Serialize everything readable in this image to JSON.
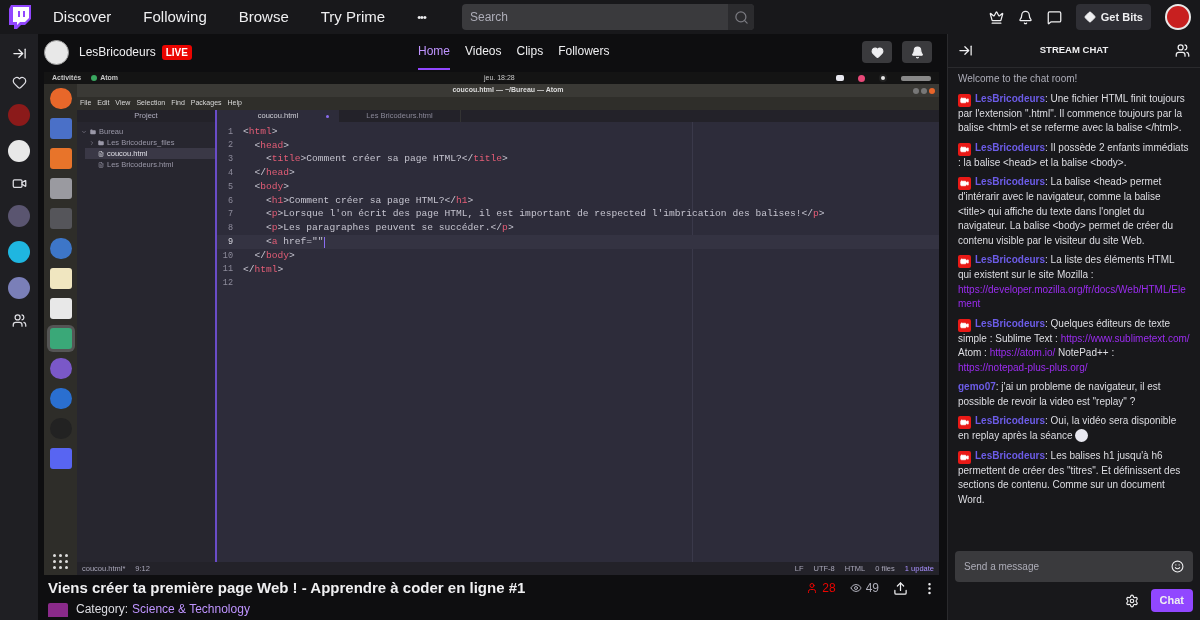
{
  "nav": {
    "items": [
      "Discover",
      "Following",
      "Browse",
      "Try Prime"
    ],
    "more": "•••",
    "search": {
      "placeholder": "Search"
    },
    "get_bits": "Get Bits"
  },
  "sidebar": {
    "items": [
      {
        "kind": "heart"
      },
      {
        "kind": "avatar",
        "color": "#8b1a1a"
      },
      {
        "kind": "avatar",
        "color": "#e8e8e8"
      },
      {
        "kind": "video"
      },
      {
        "kind": "avatar",
        "color": "#5a5570"
      },
      {
        "kind": "avatar",
        "color": "#1fb6e0"
      },
      {
        "kind": "avatar",
        "color": "#7a7fb8"
      },
      {
        "kind": "people"
      }
    ]
  },
  "channel": {
    "name": "LesBricodeurs",
    "live": "LIVE",
    "tabs": [
      {
        "label": "Home",
        "selected": true
      },
      {
        "label": "Videos",
        "selected": false
      },
      {
        "label": "Clips",
        "selected": false
      },
      {
        "label": "Followers",
        "selected": false
      }
    ]
  },
  "video": {
    "desktop": {
      "activities": "Activités",
      "app": "Atom",
      "clock": "jeu. 18:28"
    },
    "window_title": "coucou.html — ~/Bureau — Atom",
    "menu": [
      "File",
      "Edit",
      "View",
      "Selection",
      "Find",
      "Packages",
      "Help"
    ],
    "project": "Project",
    "tree": [
      {
        "label": "Bureau",
        "kind": "folder",
        "expanded": true,
        "selected": false,
        "children": [
          {
            "label": "Les Bricodeurs_files",
            "kind": "folder",
            "expanded": false,
            "selected": false
          },
          {
            "label": "coucou.html",
            "kind": "file",
            "selected": true
          },
          {
            "label": "Les Bricodeurs.html",
            "kind": "file",
            "selected": false
          }
        ]
      }
    ],
    "tabs": [
      {
        "label": "coucou.html",
        "selected": true,
        "modified": true
      },
      {
        "label": "Les Bricodeurs.html",
        "selected": false,
        "modified": false
      }
    ],
    "lines": [
      {
        "number": "1",
        "text": "<html>",
        "current": false
      },
      {
        "number": "2",
        "text": "  <head>",
        "current": false
      },
      {
        "number": "3",
        "text": "    <title>Comment créer sa page HTML?</title>",
        "current": false
      },
      {
        "number": "4",
        "text": "  </head>",
        "current": false
      },
      {
        "number": "5",
        "text": "  <body>",
        "current": false
      },
      {
        "number": "6",
        "text": "    <h1>Comment créer sa page HTML?</h1>",
        "current": false
      },
      {
        "number": "7",
        "text": "    <p>Lorsque l'on écrit des page HTML, il est important de respected l'imbrication des balises!</p>",
        "current": false
      },
      {
        "number": "8",
        "text": "    <p>Les paragraphes peuvent se succéder.</p>",
        "current": false
      },
      {
        "number": "9",
        "text": "    <a href=\"\"",
        "current": true
      },
      {
        "number": "10",
        "text": "  </body>",
        "current": false
      },
      {
        "number": "11",
        "text": "</html>",
        "current": false
      },
      {
        "number": "12",
        "current": false
      }
    ],
    "status_left": [
      "coucou.html*",
      "9:12"
    ],
    "status_right": [
      "LF",
      "UTF-8",
      "HTML",
      "0 files",
      "1 update"
    ]
  },
  "stream": {
    "title": "Viens créer ta première page Web ! - Apprendre à coder en ligne #1",
    "viewers": "28",
    "views": "49",
    "category_label": "Category:",
    "category": "Science & Technology"
  },
  "chat": {
    "title": "STREAM CHAT",
    "welcome": "Welcome to the chat room!",
    "messages": [
      {
        "user": "LesBricodeurs",
        "badge": true,
        "parts": [
          {
            "kind": "text",
            "text": ": Une fichier HTML finit toujours par l'extension \".html\". Il commence toujours par la balise <html> et se referme avec la balise </html>."
          }
        ]
      },
      {
        "user": "LesBricodeurs",
        "badge": true,
        "parts": [
          {
            "kind": "text",
            "text": ": Il possède 2 enfants immédiats : la balise <head> et la balise <body>."
          }
        ]
      },
      {
        "user": "LesBricodeurs",
        "badge": true,
        "parts": [
          {
            "kind": "text",
            "text": ": La balise <head> permet d'intérarir avec le navigateur, comme la balise <title> qui affiche du texte dans l'onglet du navigateur. La balise <body> permet de créer du contenu visible par le visiteur du site Web."
          }
        ]
      },
      {
        "user": "LesBricodeurs",
        "badge": true,
        "parts": [
          {
            "kind": "text",
            "text": ": La liste des éléments HTML qui existent sur le site Mozilla : "
          },
          {
            "kind": "block_link",
            "text": "https://developer.mozilla.org/fr/docs/Web/HTML/Element"
          }
        ]
      },
      {
        "user": "LesBricodeurs",
        "badge": true,
        "parts": [
          {
            "kind": "text",
            "text": ": Quelques éditeurs de texte simple : Sublime Text : "
          },
          {
            "kind": "link",
            "text": "https://www.sublimetext.com/"
          },
          {
            "kind": "text",
            "text": " Atom : "
          },
          {
            "kind": "link",
            "text": "https://atom.io/"
          },
          {
            "kind": "text",
            "text": " NotePad++ : "
          },
          {
            "kind": "link",
            "text": "https://notepad-plus-plus.org/"
          }
        ]
      },
      {
        "user": "gemo07",
        "badge": false,
        "parts": [
          {
            "kind": "text",
            "text": ": j'ai un probleme de navigateur, il est possible de revoir la video est \"replay\" ?"
          }
        ]
      },
      {
        "user": "LesBricodeurs",
        "badge": true,
        "parts": [
          {
            "kind": "text",
            "text": ": Oui, la vidéo sera disponible en replay après la séance "
          },
          {
            "kind": "emote"
          }
        ]
      },
      {
        "user": "LesBricodeurs",
        "badge": true,
        "parts": [
          {
            "kind": "text",
            "text": ": Les balises h1 jusqu'à h6 permettent de créer des \"titres\". Et définissent des sections de contenu. Comme sur un document Word."
          }
        ]
      }
    ],
    "input": {
      "placeholder": "Send a message"
    },
    "send": "Chat"
  }
}
